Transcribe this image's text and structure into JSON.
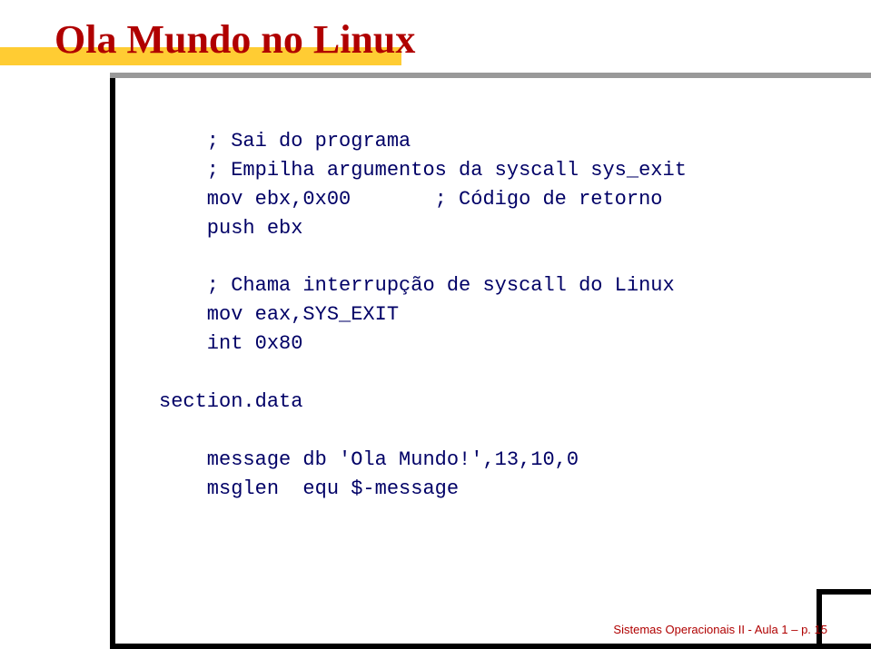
{
  "title": "Ola Mundo no Linux",
  "code": {
    "l1": "    ; Sai do programa",
    "l2": "    ; Empilha argumentos da syscall sys_exit",
    "l3": "    mov ebx,0x00       ; Código de retorno",
    "l4": "    push ebx",
    "l5": "",
    "l6": "    ; Chama interrupção de syscall do Linux",
    "l7": "    mov eax,SYS_EXIT",
    "l8": "    int 0x80",
    "l9": "",
    "l10": "section.data",
    "l11": "",
    "l12": "    message db 'Ola Mundo!',13,10,0",
    "l13": "    msglen  equ $-message"
  },
  "footer": "Sistemas Operacionais II - Aula 1 – p. 15"
}
